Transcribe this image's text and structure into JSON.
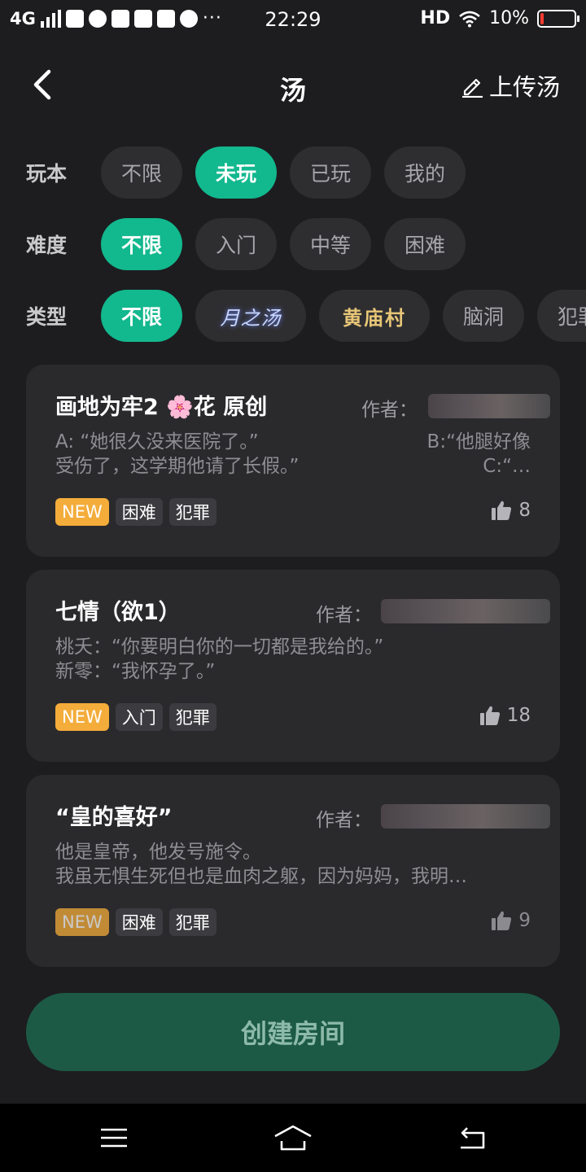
{
  "status_bar": {
    "network": "4G",
    "time": "22:29",
    "hd": "HD",
    "battery_text": "10%",
    "battery_level": 0.1,
    "battery_color": "#ff3b30",
    "more": "···"
  },
  "header": {
    "title": "汤",
    "upload_label": "上传汤",
    "back_icon": "chevron-left-icon",
    "upload_icon": "pencil-icon"
  },
  "filters": {
    "play": {
      "label": "玩本",
      "options": [
        "不限",
        "未玩",
        "已玩",
        "我的"
      ],
      "selected": "未玩"
    },
    "difficulty": {
      "label": "难度",
      "options": [
        "不限",
        "入门",
        "中等",
        "困难"
      ],
      "selected": "不限"
    },
    "type": {
      "label": "类型",
      "options": [
        "不限",
        "月之汤",
        "黄庙村",
        "脑洞",
        "犯罪"
      ],
      "selected": "不限"
    }
  },
  "cards": [
    {
      "title": "画地为牢2 🌸花 原创",
      "author_label": "作者：",
      "desc_line1_left": "A: “她很久没来医院了。”",
      "desc_line1_right": "B:“他腿好像",
      "desc_line2_left": "受伤了，这学期他请了长假。”",
      "desc_line2_right": "C:“…",
      "tags": [
        "NEW",
        "困难",
        "犯罪"
      ],
      "likes": "8"
    },
    {
      "title": "七情（欲1）",
      "author_label": "作者：",
      "desc_line1_left": "桃夭：“你要明白你的一切都是我给的。”",
      "desc_line2_left": "新零：“我怀孕了。”",
      "tags": [
        "NEW",
        "入门",
        "犯罪"
      ],
      "likes": "18"
    },
    {
      "title": "“皇的喜好”",
      "author_label": "作者：",
      "desc_line1_left": "他是皇帝，他发号施令。",
      "desc_line2_left": "我虽无惧生死但也是血肉之躯，因为妈妈，我明…",
      "tags": [
        "NEW",
        "困难",
        "犯罪"
      ],
      "likes": "9"
    }
  ],
  "create_button": "创建房间",
  "colors": {
    "accent": "#12b88e",
    "new_tag": "#f4ac3a",
    "background": "#1d1d1f",
    "card": "#2a2a2d",
    "create_button": "#1c5a45"
  }
}
